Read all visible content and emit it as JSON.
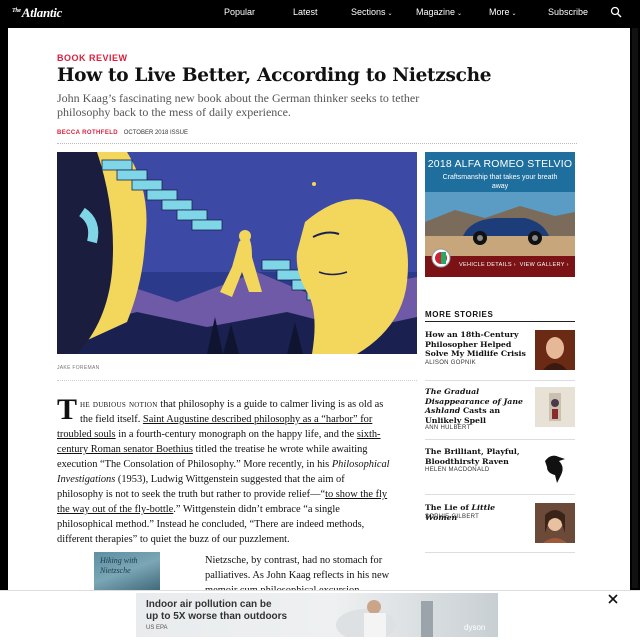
{
  "nav": {
    "logo": "Atlantic",
    "logo_prefix": "The",
    "items": [
      {
        "label": "Popular",
        "has_menu": false
      },
      {
        "label": "Latest",
        "has_menu": false
      },
      {
        "label": "Sections",
        "has_menu": true
      },
      {
        "label": "Magazine",
        "has_menu": true
      },
      {
        "label": "More",
        "has_menu": true
      },
      {
        "label": "Subscribe",
        "has_menu": false
      }
    ],
    "chevron": "⌄",
    "search_icon": "search-icon"
  },
  "article": {
    "kicker": "BOOK REVIEW",
    "title": "How to Live Better, According to Nietzsche",
    "dek": "John Kaag’s fascinating new book about the German thinker seeks to tether philosophy back to the mess of daily experience.",
    "author": "BECCA ROTHFELD",
    "issue": "OCTOBER 2018 ISSUE",
    "image_credit": "JAKE FOREMAN",
    "dropcap": "T",
    "p1": {
      "lead_smallcaps": "he dubious notion",
      "t1": " that philosophy is a guide to calmer living is as old as the field itself. ",
      "link1": "Saint Augustine described philosophy as a “harbor” for troubled souls",
      "t2": " in a fourth-century monograph on the happy life, and the ",
      "link2": "sixth-century Roman senator Boethius",
      "t3": " titled the treatise he wrote while awaiting execution “The Consolation of Philosophy.” More recently, in his ",
      "italic1": "Philosophical Investigations",
      "t4": " (1953), Ludwig Wittgenstein suggested that the aim of philosophy is not to seek the truth but rather to provide relief—“",
      "link3": "to show the fly the way out of the fly-bottle",
      "t5": ".” Wittgenstein didn’t embrace “a single philosophical method.” Instead he concluded, “There are indeed methods, different therapies” to quiet the buzz of our puzzlement."
    },
    "p2": "Nietzsche, by contrast, had no stomach for palliatives. As John Kaag reflects in his new memoir cum philosophical excursion,",
    "book_cover_text": "Hiking with Nietzsche"
  },
  "ad": {
    "title": "2018 ALFA ROMEO STELVIO",
    "subtitle": "Craftsmanship that takes your breath away",
    "link1": "VEHICLE DETAILS",
    "link2": "VIEW GALLERY",
    "sep": "›",
    "colors": {
      "bg": "#1f6f9e",
      "footer": "#7a1216"
    }
  },
  "more_stories": {
    "heading": "MORE STORIES",
    "items": [
      {
        "title": "How an 18th-Century Philosopher Helped Solve My Midlife Crisis",
        "author": "ALISON GOPNIK"
      },
      {
        "title_italic": "The Gradual Disappearance of Jane Ashland",
        "title_rest": " Casts an Unlikely Spell",
        "author": "ANN HULBERT"
      },
      {
        "title": "The Brilliant, Playful, Bloodthirsty Raven",
        "author": "HELEN MACDONALD"
      },
      {
        "title_plain": "The Lie of ",
        "title_italic": "Little Women",
        "author": "SOPHIE GILBERT"
      }
    ]
  },
  "banner": {
    "line1": "Indoor air pollution can be",
    "line2": "up to 5X worse than outdoors",
    "source": "US EPA",
    "brand": "dyson"
  },
  "colors": {
    "accent": "#d8203d"
  }
}
